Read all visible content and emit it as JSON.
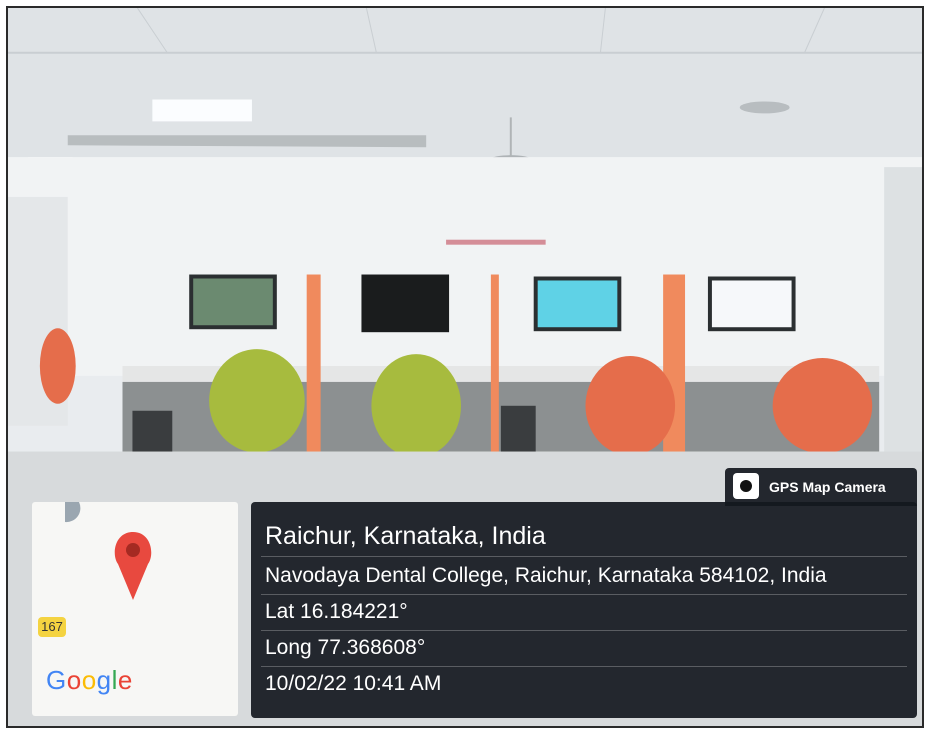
{
  "badge": {
    "label": "GPS Map Camera",
    "icon": "camera-icon"
  },
  "location": {
    "title": "Raichur, Karnataka, India",
    "address": "Navodaya Dental College, Raichur, Karnataka 584102, India",
    "lat": "Lat 16.184221°",
    "long": "Long 77.368608°",
    "datetime": "10/02/22 10:41 AM"
  },
  "map": {
    "road_number": "167",
    "logo": "Google",
    "pin_icon": "map-pin-icon"
  },
  "colors": {
    "panel": "#14181e",
    "pin": "#e8493f",
    "chair_green": "#a7bb3e",
    "chair_orange": "#e56d4b",
    "divider": "#f08a5d"
  }
}
